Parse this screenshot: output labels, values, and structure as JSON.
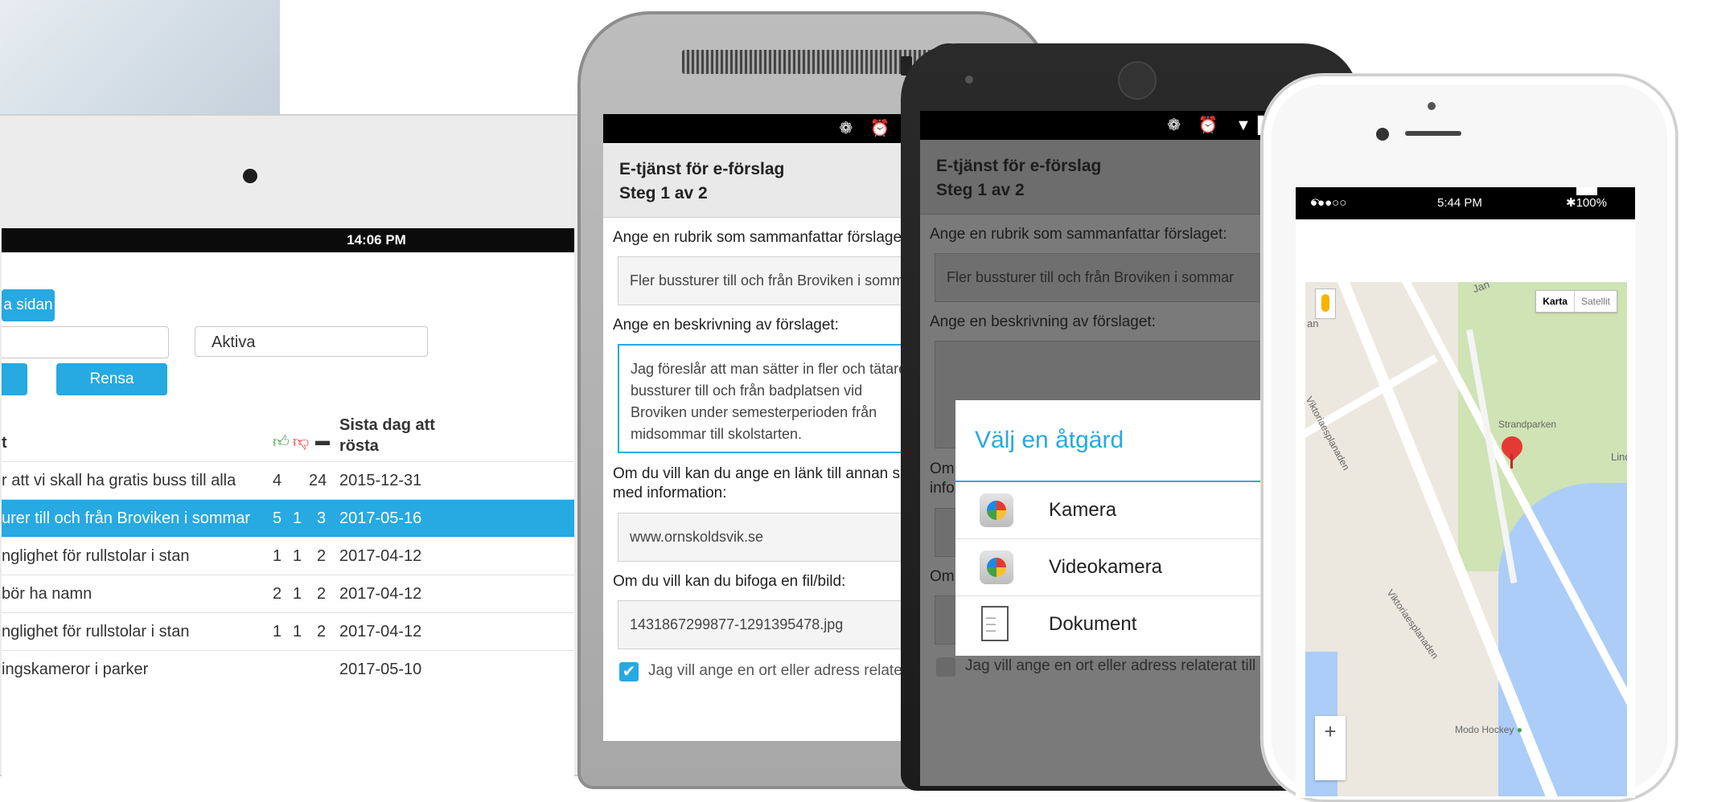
{
  "tablet": {
    "status_time": "14:06 PM",
    "top_button": "a sidan",
    "filter_select": "Aktiva",
    "clear_button": "Rensa",
    "col_last_day": "Sista dag att",
    "col_last_day_2": "rösta",
    "col_title_fragment": "t",
    "rows": [
      {
        "title": "r att vi skall ha gratis buss till alla",
        "up": "4",
        "down": "",
        "comments": "24",
        "date": "2015-12-31"
      },
      {
        "title": "urer till och från Broviken i sommar",
        "up": "5",
        "down": "1",
        "comments": "3",
        "date": "2017-05-16"
      },
      {
        "title": "nglighet för rullstolar i stan",
        "up": "1",
        "down": "1",
        "comments": "2",
        "date": "2017-04-12"
      },
      {
        "title": "bör ha namn",
        "up": "2",
        "down": "1",
        "comments": "2",
        "date": "2017-04-12"
      },
      {
        "title": "nglighet för rullstolar i stan",
        "up": "1",
        "down": "1",
        "comments": "2",
        "date": "2017-04-12"
      },
      {
        "title": "ingskameror i parker",
        "up": "",
        "down": "",
        "comments": "",
        "date": "2017-05-10"
      }
    ]
  },
  "form": {
    "title": "E-tjänst för e-förslag",
    "step": "Steg 1 av 2",
    "heading_label": "Ange en rubrik som sammanfattar förslaget:",
    "heading_value": "Fler bussturer till och från Broviken i sommar",
    "description_label": "Ange en beskrivning av förslaget:",
    "description_value": "Jag föreslår att man sätter in fler och tätare bussturer till och från badplatsen vid Broviken under semesterperioden från midsommar till skolstarten.",
    "link_label": "Om du vill kan du ange en länk till annan sida med information:",
    "link_value": "www.ornskoldsvik.se",
    "file_label": "Om du vill kan du bifoga en fil/bild:",
    "file_value": "1431867299877-1291395478.jpg",
    "location_checkbox": "Jag vill ange en ort eller adress relaterat till förslaget"
  },
  "dialog": {
    "title": "Välj en åtgärd",
    "options": [
      "Kamera",
      "Videokamera",
      "Dokument"
    ]
  },
  "iphone": {
    "carrier": "●●●○○ S44",
    "time": "5:44 PM",
    "battery": "100%",
    "map_type_map": "Karta",
    "map_type_sat": "Satellit",
    "labels": {
      "park": "Strandparken",
      "street1": "Viktoriaesplanaden",
      "street2": "Viktoriaesplanaden",
      "hockey": "Modo Hockey",
      "lind": "Lind",
      "an": "an",
      "jan": "Jan"
    },
    "zoom_in": "+"
  },
  "colors": {
    "accent": "#27a9e1",
    "pin": "#e53935",
    "park": "#cfe3b5",
    "water": "#abcdf8"
  }
}
